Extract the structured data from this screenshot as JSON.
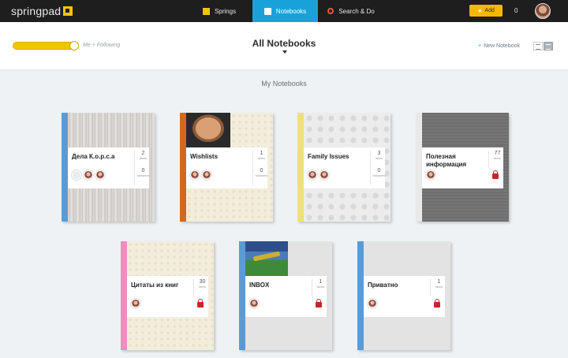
{
  "app": {
    "logo_text": "springpad"
  },
  "nav": {
    "springs": "Springs",
    "notebooks": "Notebooks",
    "search": "Search & Do",
    "add_label": "Add",
    "count": "0"
  },
  "header": {
    "toggle_label": "Me + Following",
    "title": "All Notebooks",
    "new_notebook": "New Notebook"
  },
  "section_label": "My Notebooks",
  "colors": {
    "accent_blue": "#19a2d9",
    "accent_yellow": "#f5c400",
    "lock_red": "#c8242a"
  },
  "notebooks": [
    {
      "name": "Дела К.о.р.с.а",
      "items": "2",
      "items_label": "items",
      "followers": "0",
      "followers_label": "followers",
      "spine_color": "#5b9bd5",
      "locked": false
    },
    {
      "name": "Wishlists",
      "items": "1",
      "items_label": "items",
      "followers": "0",
      "followers_label": "followers",
      "spine_color": "#d2691e",
      "locked": false
    },
    {
      "name": "Family Issues",
      "items": "3",
      "items_label": "items",
      "followers": "0",
      "followers_label": "followers",
      "spine_color": "#efe07a",
      "locked": false
    },
    {
      "name": "Полезная информация",
      "items": "77",
      "items_label": "items",
      "spine_color": "#e9e9e9",
      "locked": true
    },
    {
      "name": "Цитаты из книг",
      "items": "30",
      "items_label": "items",
      "spine_color": "#f08cc0",
      "locked": true
    },
    {
      "name": "INBOX",
      "items": "1",
      "items_label": "items",
      "spine_color": "#5b9bd5",
      "locked": true
    },
    {
      "name": "Приватно",
      "items": "1",
      "items_label": "items",
      "spine_color": "#5b9bd5",
      "locked": true
    }
  ]
}
